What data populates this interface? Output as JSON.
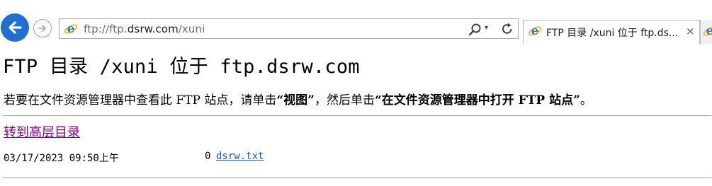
{
  "browser": {
    "url_prefix": "ftp://ftp.",
    "url_domain": "dsrw.com",
    "url_suffix": "/xuni",
    "tab_title": "FTP 目录 /xuni 位于 ftp.ds...",
    "tab_close": "×",
    "dropdown_glyph": "▾",
    "icons": [
      "back-arrow-icon",
      "forward-arrow-icon",
      "ie-icon",
      "search-icon",
      "refresh-icon",
      "close-icon"
    ],
    "accent": "#1e6fd0"
  },
  "page": {
    "title": "FTP 目录 /xuni 位于 ftp.dsrw.com",
    "instructions": {
      "part1": "若要在文件资源管理器中查看此 FTP 站点，请单击",
      "bold1": "“视图”",
      "part2": "，然后单击",
      "bold2": "“在文件资源管理器中打开 FTP 站点”",
      "part3": "。"
    },
    "parent_link": "转到高层目录",
    "link_visited_color": "#800080",
    "link_color": "#1a5dc9"
  },
  "listing": [
    {
      "date": "03/17/2023 09:50上午",
      "size": "0",
      "name": "dsrw.txt"
    }
  ]
}
